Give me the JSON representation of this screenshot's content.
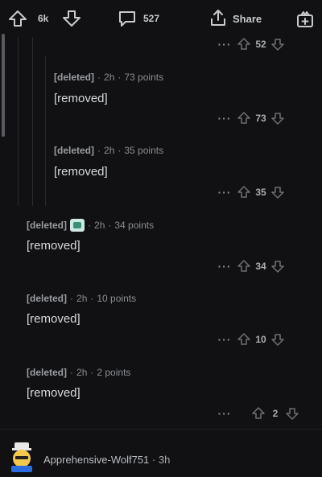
{
  "topbar": {
    "upvote_count": "6k",
    "comment_count": "527",
    "share_label": "Share"
  },
  "comments": [
    {
      "score": "52"
    },
    {
      "author": "[deleted]",
      "time": "2h",
      "points": "73 points",
      "body": "[removed]",
      "score": "73"
    },
    {
      "author": "[deleted]",
      "time": "2h",
      "points": "35 points",
      "body": "[removed]",
      "score": "35"
    },
    {
      "author": "[deleted]",
      "time": "2h",
      "points": "34 points",
      "body": "[removed]",
      "score": "34"
    },
    {
      "author": "[deleted]",
      "time": "2h",
      "points": "10 points",
      "body": "[removed]",
      "score": "10"
    },
    {
      "author": "[deleted]",
      "time": "2h",
      "points": "2 points",
      "body": "[removed]",
      "score": "2"
    }
  ],
  "next_comment": {
    "author": "Apprehensive-Wolf751",
    "time": "3h"
  },
  "separator": "·",
  "more_options": "···",
  "colors": {
    "background": "#111114",
    "text": "#d7dadc",
    "muted": "#8a8d90"
  }
}
